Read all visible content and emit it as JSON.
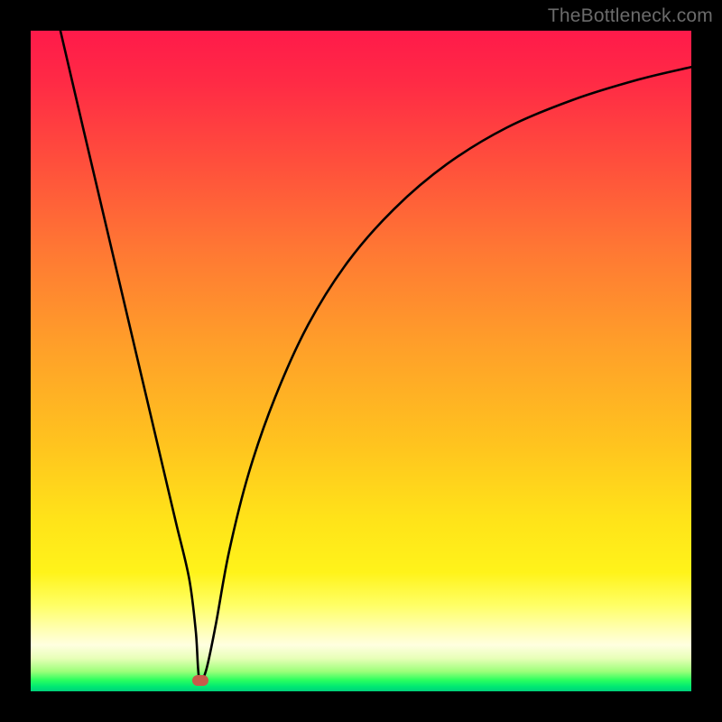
{
  "watermark": "TheBottleneck.com",
  "colors": {
    "frame": "#000000",
    "curve": "#000000",
    "marker": "#c85a4a",
    "gradient_top": "#ff1a4a",
    "gradient_bottom": "#00d07a"
  },
  "chart_data": {
    "type": "line",
    "title": "",
    "xlabel": "",
    "ylabel": "",
    "xlim": [
      0,
      100
    ],
    "ylim": [
      0,
      100
    ],
    "x": [
      4.5,
      8,
      12,
      16,
      20,
      22,
      24,
      25,
      25.5,
      26.5,
      28,
      30,
      33,
      37,
      42,
      48,
      55,
      63,
      72,
      82,
      92,
      100
    ],
    "values": [
      100,
      85,
      68,
      51,
      34,
      25.5,
      17,
      9,
      2,
      3,
      10,
      21,
      33,
      44.5,
      55.5,
      65,
      73,
      79.8,
      85.3,
      89.5,
      92.6,
      94.5
    ],
    "marker": {
      "x": 25.7,
      "y": 1.6
    },
    "annotations": []
  }
}
